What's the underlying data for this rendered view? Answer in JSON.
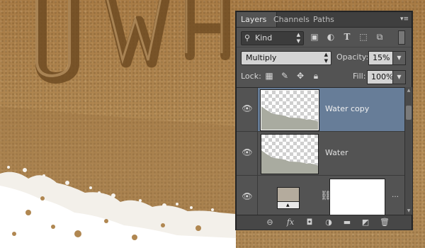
{
  "tabs": [
    {
      "label": "Layers",
      "active": true
    },
    {
      "label": "Channels",
      "active": false
    },
    {
      "label": "Paths",
      "active": false
    }
  ],
  "filter": {
    "kind_label": "Kind",
    "icons": [
      "image-filter-icon",
      "adjustment-filter-icon",
      "type-filter-icon",
      "shape-filter-icon",
      "smart-object-filter-icon"
    ]
  },
  "blend": {
    "mode": "Multiply",
    "opacity_label": "Opacity:",
    "opacity_value": "15%"
  },
  "lock": {
    "label": "Lock:",
    "fill_label": "Fill:",
    "fill_value": "100%"
  },
  "layers": [
    {
      "name": "Water copy",
      "selected": true,
      "visible": true
    },
    {
      "name": "Water",
      "selected": false,
      "visible": true
    },
    {
      "name": "",
      "selected": false,
      "visible": true,
      "type": "adjustment-with-mask"
    }
  ],
  "footer_icons": [
    "link-layers-icon",
    "fx-icon",
    "add-mask-icon",
    "adjustment-layer-icon",
    "new-group-icon",
    "new-layer-icon",
    "trash-icon"
  ],
  "colors": {
    "panel": "#535353",
    "selected_layer": "#677d98",
    "sand": "#b08751"
  }
}
